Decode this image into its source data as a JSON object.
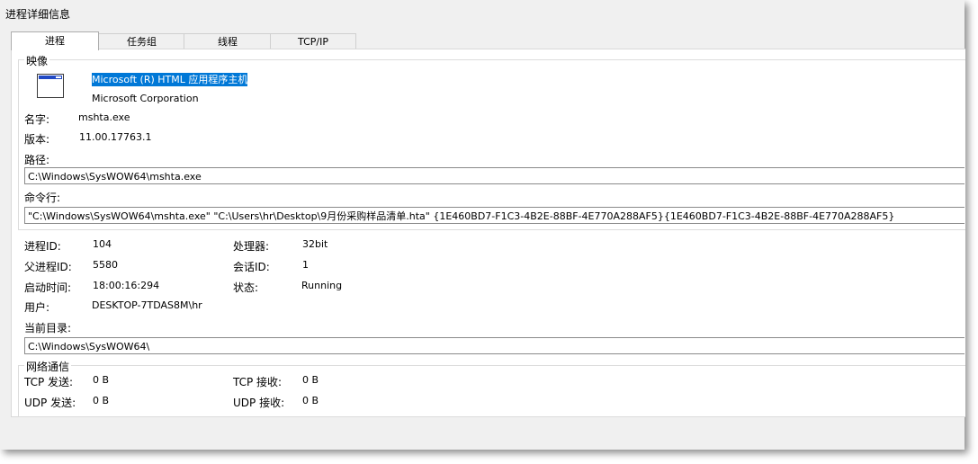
{
  "window": {
    "title": "进程详细信息"
  },
  "tabs": [
    {
      "label": "进程"
    },
    {
      "label": "任务组"
    },
    {
      "label": "线程"
    },
    {
      "label": "TCP/IP"
    }
  ],
  "image_group": {
    "legend": "映像",
    "icon": "application-window-icon",
    "description": "Microsoft (R) HTML 应用程序主机",
    "company": "Microsoft Corporation",
    "name_label": "名字:",
    "name_value": "mshta.exe",
    "version_label": "版本:",
    "version_value": "11.00.17763.1",
    "path_label": "路径:",
    "path_value": "C:\\Windows\\SysWOW64\\mshta.exe",
    "cmdline_label": "命令行:",
    "cmdline_value": "\"C:\\Windows\\SysWOW64\\mshta.exe\" \"C:\\Users\\hr\\Desktop\\9月份采购样品清单.hta\" {1E460BD7-F1C3-4B2E-88BF-4E770A288AF5}{1E460BD7-F1C3-4B2E-88BF-4E770A288AF5}"
  },
  "process_info": {
    "pid_label": "进程ID:",
    "pid_value": "104",
    "arch_label": "处理器:",
    "arch_value": "32bit",
    "ppid_label": "父进程ID:",
    "ppid_value": "5580",
    "session_label": "会话ID:",
    "session_value": "1",
    "start_label": "启动时间:",
    "start_value": "18:00:16:294",
    "state_label": "状态:",
    "state_value": "Running",
    "user_label": "用户:",
    "user_value": "DESKTOP-7TDAS8M\\hr",
    "cwd_label": "当前目录:",
    "cwd_value": "C:\\Windows\\SysWOW64\\"
  },
  "network_group": {
    "legend": "网络通信",
    "tcp_send_label": "TCP 发送:",
    "tcp_send_value": "0 B",
    "tcp_recv_label": "TCP 接收:",
    "tcp_recv_value": "0 B",
    "udp_send_label": "UDP 发送:",
    "udp_send_value": "0 B",
    "udp_recv_label": "UDP 接收:",
    "udp_recv_value": "0 B"
  },
  "colors": {
    "selection": "#0078d7",
    "window_bg": "#f0f0f0",
    "panel_bg": "#ffffff"
  }
}
